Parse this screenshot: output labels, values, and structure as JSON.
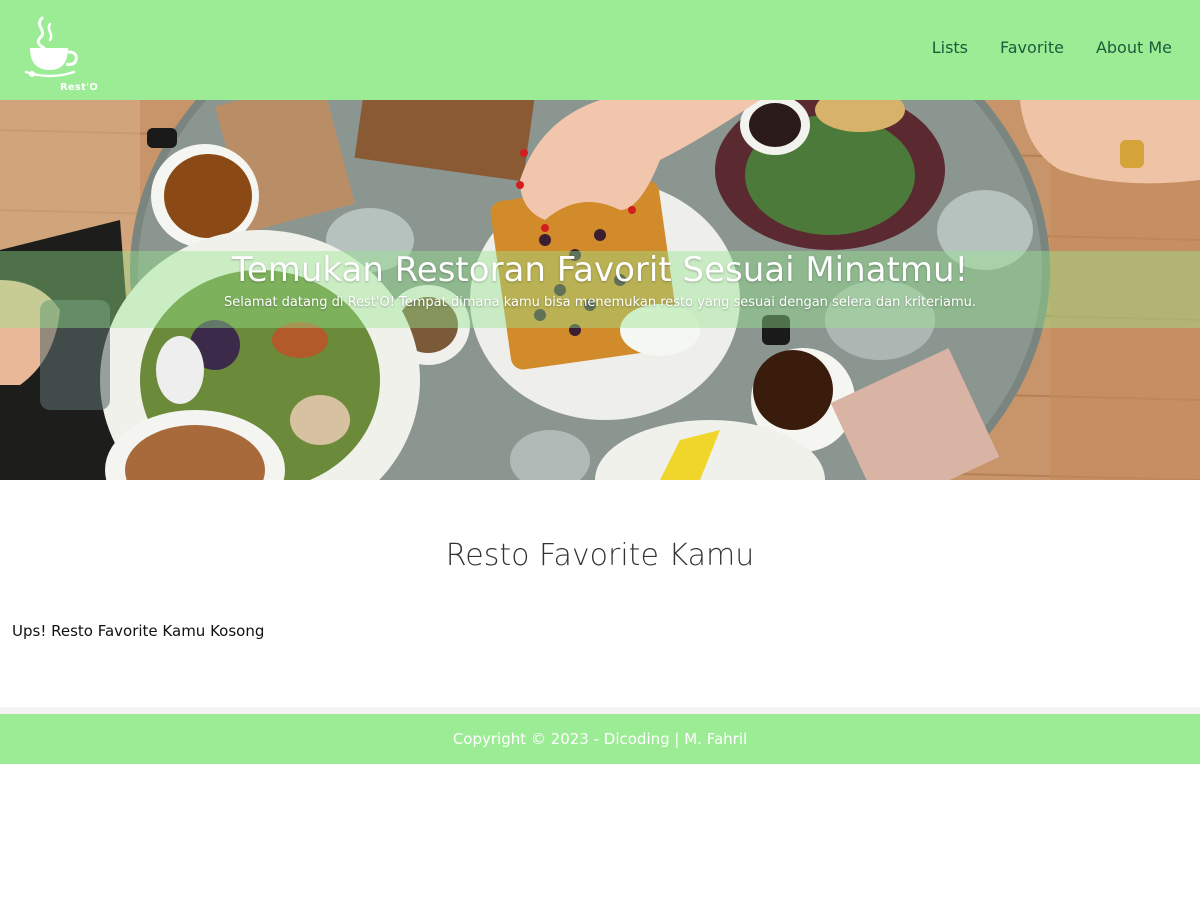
{
  "app": {
    "logo_text": "Rest'O",
    "logo_icon": "coffee-cup-icon"
  },
  "nav": {
    "items": [
      {
        "label": "Lists"
      },
      {
        "label": "Favorite"
      },
      {
        "label": "About Me"
      }
    ]
  },
  "hero": {
    "image": "restaurant-table-food-photo",
    "title": "Temukan Restoran Favorit Sesuai Minatmu!",
    "subtitle": "Selamat datang di Rest'O! Tempat dimana kamu bisa menemukan resto yang sesuai dengan selera dan kriteriamu."
  },
  "main": {
    "section_title": "Resto Favorite Kamu",
    "empty_message": "Ups! Resto Favorite Kamu Kosong"
  },
  "footer": {
    "copyright": "Copyright © 2023 - Dicoding | M. Fahril"
  },
  "colors": {
    "app_bar": "#9bec95",
    "nav_text": "#1c5c3c",
    "footer": "#9bec95"
  }
}
